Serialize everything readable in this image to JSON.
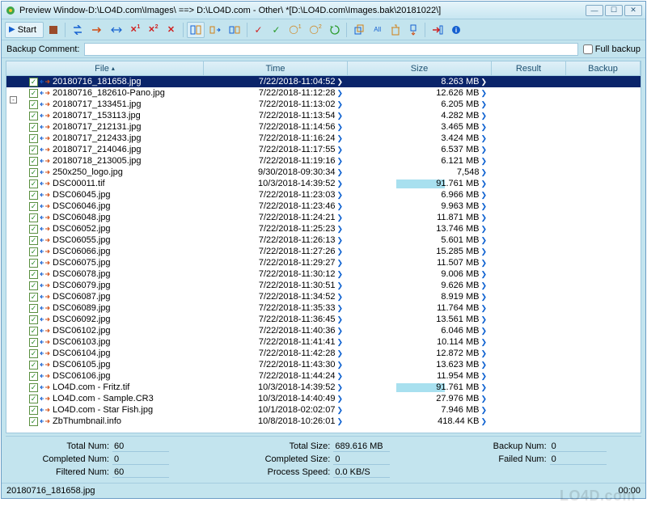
{
  "window": {
    "title": "Preview Window-D:\\LO4D.com\\Images\\ ==> D:\\LO4D.com - Other\\ *[D:\\LO4D.com\\Images.bak\\20181022\\]"
  },
  "toolbar": {
    "start_label": "Start"
  },
  "comment": {
    "label": "Backup Comment:",
    "value": "",
    "full_backup_label": "Full backup",
    "full_backup_checked": false
  },
  "columns": {
    "file": "File",
    "time": "Time",
    "size": "Size",
    "result": "Result",
    "backup": "Backup"
  },
  "rows": [
    {
      "selected": true,
      "name": "20180716_181658.jpg",
      "time": "7/22/2018-11:04:52",
      "size": "8.263 MB",
      "hl": false
    },
    {
      "selected": false,
      "name": "20180716_182610-Pano.jpg",
      "time": "7/22/2018-11:12:28",
      "size": "12.626 MB",
      "hl": false
    },
    {
      "selected": false,
      "name": "20180717_133451.jpg",
      "time": "7/22/2018-11:13:02",
      "size": "6.205 MB",
      "hl": false
    },
    {
      "selected": false,
      "name": "20180717_153113.jpg",
      "time": "7/22/2018-11:13:54",
      "size": "4.282 MB",
      "hl": false
    },
    {
      "selected": false,
      "name": "20180717_212131.jpg",
      "time": "7/22/2018-11:14:56",
      "size": "3.465 MB",
      "hl": false
    },
    {
      "selected": false,
      "name": "20180717_212433.jpg",
      "time": "7/22/2018-11:16:24",
      "size": "3.424 MB",
      "hl": false
    },
    {
      "selected": false,
      "name": "20180717_214046.jpg",
      "time": "7/22/2018-11:17:55",
      "size": "6.537 MB",
      "hl": false
    },
    {
      "selected": false,
      "name": "20180718_213005.jpg",
      "time": "7/22/2018-11:19:16",
      "size": "6.121 MB",
      "hl": false
    },
    {
      "selected": false,
      "name": "250x250_logo.jpg",
      "time": "9/30/2018-09:30:34",
      "size": "7,548",
      "hl": false
    },
    {
      "selected": false,
      "name": "DSC00011.tif",
      "time": "10/3/2018-14:39:52",
      "size": "91.761 MB",
      "hl": true
    },
    {
      "selected": false,
      "name": "DSC06045.jpg",
      "time": "7/22/2018-11:23:03",
      "size": "6.966 MB",
      "hl": false
    },
    {
      "selected": false,
      "name": "DSC06046.jpg",
      "time": "7/22/2018-11:23:46",
      "size": "9.963 MB",
      "hl": false
    },
    {
      "selected": false,
      "name": "DSC06048.jpg",
      "time": "7/22/2018-11:24:21",
      "size": "11.871 MB",
      "hl": false
    },
    {
      "selected": false,
      "name": "DSC06052.jpg",
      "time": "7/22/2018-11:25:23",
      "size": "13.746 MB",
      "hl": false
    },
    {
      "selected": false,
      "name": "DSC06055.jpg",
      "time": "7/22/2018-11:26:13",
      "size": "5.601 MB",
      "hl": false
    },
    {
      "selected": false,
      "name": "DSC06066.jpg",
      "time": "7/22/2018-11:27:26",
      "size": "15.285 MB",
      "hl": false
    },
    {
      "selected": false,
      "name": "DSC06075.jpg",
      "time": "7/22/2018-11:29:27",
      "size": "11.507 MB",
      "hl": false
    },
    {
      "selected": false,
      "name": "DSC06078.jpg",
      "time": "7/22/2018-11:30:12",
      "size": "9.006 MB",
      "hl": false
    },
    {
      "selected": false,
      "name": "DSC06079.jpg",
      "time": "7/22/2018-11:30:51",
      "size": "9.626 MB",
      "hl": false
    },
    {
      "selected": false,
      "name": "DSC06087.jpg",
      "time": "7/22/2018-11:34:52",
      "size": "8.919 MB",
      "hl": false
    },
    {
      "selected": false,
      "name": "DSC06089.jpg",
      "time": "7/22/2018-11:35:33",
      "size": "11.764 MB",
      "hl": false
    },
    {
      "selected": false,
      "name": "DSC06092.jpg",
      "time": "7/22/2018-11:36:45",
      "size": "13.561 MB",
      "hl": false
    },
    {
      "selected": false,
      "name": "DSC06102.jpg",
      "time": "7/22/2018-11:40:36",
      "size": "6.046 MB",
      "hl": false
    },
    {
      "selected": false,
      "name": "DSC06103.jpg",
      "time": "7/22/2018-11:41:41",
      "size": "10.114 MB",
      "hl": false
    },
    {
      "selected": false,
      "name": "DSC06104.jpg",
      "time": "7/22/2018-11:42:28",
      "size": "12.872 MB",
      "hl": false
    },
    {
      "selected": false,
      "name": "DSC06105.jpg",
      "time": "7/22/2018-11:43:30",
      "size": "13.623 MB",
      "hl": false
    },
    {
      "selected": false,
      "name": "DSC06106.jpg",
      "time": "7/22/2018-11:44:24",
      "size": "11.954 MB",
      "hl": false
    },
    {
      "selected": false,
      "name": "LO4D.com - Fritz.tif",
      "time": "10/3/2018-14:39:52",
      "size": "91.761 MB",
      "hl": true
    },
    {
      "selected": false,
      "name": "LO4D.com - Sample.CR3",
      "time": "10/3/2018-14:40:49",
      "size": "27.976 MB",
      "hl": false
    },
    {
      "selected": false,
      "name": "LO4D.com - Star Fish.jpg",
      "time": "10/1/2018-02:02:07",
      "size": "7.946 MB",
      "hl": false
    },
    {
      "selected": false,
      "name": "ZbThumbnail.info",
      "time": "10/8/2018-10:26:01",
      "size": "418.44 KB",
      "hl": false
    }
  ],
  "summary": {
    "total_num_label": "Total Num:",
    "total_num": "60",
    "completed_num_label": "Completed Num:",
    "completed_num": "0",
    "filtered_num_label": "Filtered Num:",
    "filtered_num": "60",
    "total_size_label": "Total Size:",
    "total_size": "689.616 MB",
    "completed_size_label": "Completed Size:",
    "completed_size": "0",
    "process_speed_label": "Process Speed:",
    "process_speed": "0.0 KB/S",
    "backup_num_label": "Backup Num:",
    "backup_num": "0",
    "failed_num_label": "Failed Num:",
    "failed_num": "0"
  },
  "status": {
    "left": "20180716_181658.jpg",
    "right": "00:00"
  },
  "watermark": "LO4D.com"
}
